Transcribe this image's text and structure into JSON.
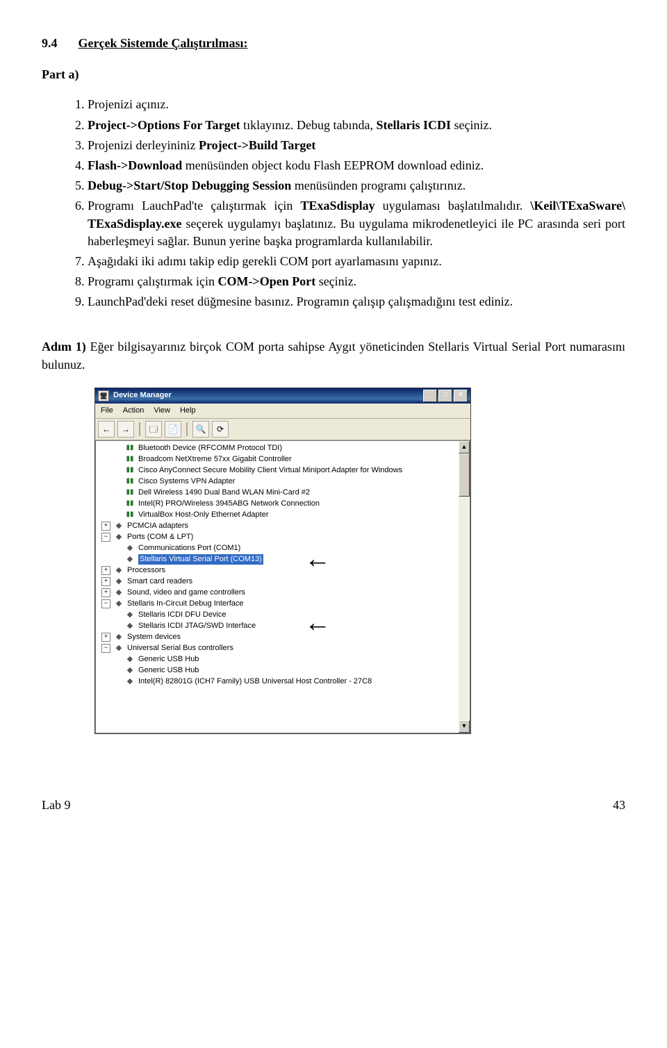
{
  "section": {
    "number": "9.4",
    "title": "Gerçek Sistemde Çalıştırılması:"
  },
  "part": {
    "label": "Part a)"
  },
  "steps": [
    "Projenizi açınız.",
    "<span class='b'>Project->Options For Target</span> tıklayınız. Debug tabında, <span class='b'>Stellaris ICDI</span> seçiniz.",
    "Projenizi derleyininiz <span class='b'>Project->Build Target</span>",
    "<span class='b'>Flash->Download</span> menüsünden object kodu Flash EEPROM download ediniz.",
    "<span class='b'>Debug->Start/Stop Debugging Session</span> menüsünden programı çalıştırınız.",
    "Programı LauchPad'te çalıştırmak için <span class='b'>TExaSdisplay</span> uygulaması başlatılmalıdır. <span class='b'>\\Keil\\TExaSware\\ TExaSdisplay.exe</span> seçerek uygulamyı başlatınız. Bu uygulama mikrodenetleyici ile PC arasında seri port haberleşmeyi sağlar. Bunun yerine başka programlarda kullanılabilir.",
    "Aşağıdaki iki adımı takip edip gerekli COM port ayarlamasını yapınız.",
    "Programı çalıştırmak için <span class='b'>COM->Open Port</span> seçiniz.",
    "LaunchPad'deki reset düğmesine basınız. Programın çalışıp çalışmadığını test ediniz."
  ],
  "adim": "<span class='b'>Adım 1)</span> Eğer bilgisayarınız birçok COM porta sahipse Aygıt yöneticinden Stellaris Virtual Serial Port numarasını bulunuz.",
  "dm": {
    "title": "Device Manager",
    "menus": [
      "File",
      "Action",
      "View",
      "Help"
    ],
    "nodes": [
      {
        "indent": 1,
        "exp": null,
        "icon": "net",
        "label": "Bluetooth Device (RFCOMM Protocol TDI)"
      },
      {
        "indent": 1,
        "exp": null,
        "icon": "net",
        "label": "Broadcom NetXtreme 57xx Gigabit Controller"
      },
      {
        "indent": 1,
        "exp": null,
        "icon": "net",
        "label": "Cisco AnyConnect Secure Mobility Client Virtual Miniport Adapter for Windows"
      },
      {
        "indent": 1,
        "exp": null,
        "icon": "net",
        "label": "Cisco Systems VPN Adapter"
      },
      {
        "indent": 1,
        "exp": null,
        "icon": "net",
        "label": "Dell Wireless 1490 Dual Band WLAN Mini-Card #2"
      },
      {
        "indent": 1,
        "exp": null,
        "icon": "net",
        "label": "Intel(R) PRO/Wireless 3945ABG Network Connection"
      },
      {
        "indent": 1,
        "exp": null,
        "icon": "net",
        "label": "VirtualBox Host-Only Ethernet Adapter"
      },
      {
        "indent": 0,
        "exp": "+",
        "icon": "dev",
        "label": "PCMCIA adapters"
      },
      {
        "indent": 0,
        "exp": "−",
        "icon": "dev",
        "label": "Ports (COM & LPT)"
      },
      {
        "indent": 1,
        "exp": null,
        "icon": "dev",
        "label": "Communications Port (COM1)"
      },
      {
        "indent": 1,
        "exp": null,
        "icon": "dev",
        "label": "Stellaris Virtual Serial Port (COM13)",
        "selected": true
      },
      {
        "indent": 0,
        "exp": "+",
        "icon": "dev",
        "label": "Processors"
      },
      {
        "indent": 0,
        "exp": "+",
        "icon": "dev",
        "label": "Smart card readers"
      },
      {
        "indent": 0,
        "exp": "+",
        "icon": "dev",
        "label": "Sound, video and game controllers"
      },
      {
        "indent": 0,
        "exp": "−",
        "icon": "dev",
        "label": "Stellaris In-Circuit Debug Interface"
      },
      {
        "indent": 1,
        "exp": null,
        "icon": "dev",
        "label": "Stellaris ICDI DFU Device"
      },
      {
        "indent": 1,
        "exp": null,
        "icon": "dev",
        "label": "Stellaris ICDI JTAG/SWD Interface"
      },
      {
        "indent": 0,
        "exp": "+",
        "icon": "dev",
        "label": "System devices"
      },
      {
        "indent": 0,
        "exp": "−",
        "icon": "dev",
        "label": "Universal Serial Bus controllers"
      },
      {
        "indent": 1,
        "exp": null,
        "icon": "dev",
        "label": "Generic USB Hub"
      },
      {
        "indent": 1,
        "exp": null,
        "icon": "dev",
        "label": "Generic USB Hub"
      },
      {
        "indent": 1,
        "exp": null,
        "icon": "dev",
        "label": "Intel(R) 82801G (ICH7 Family) USB Universal Host Controller - 27C8"
      }
    ]
  },
  "footer": {
    "left": "Lab 9",
    "right": "43"
  }
}
